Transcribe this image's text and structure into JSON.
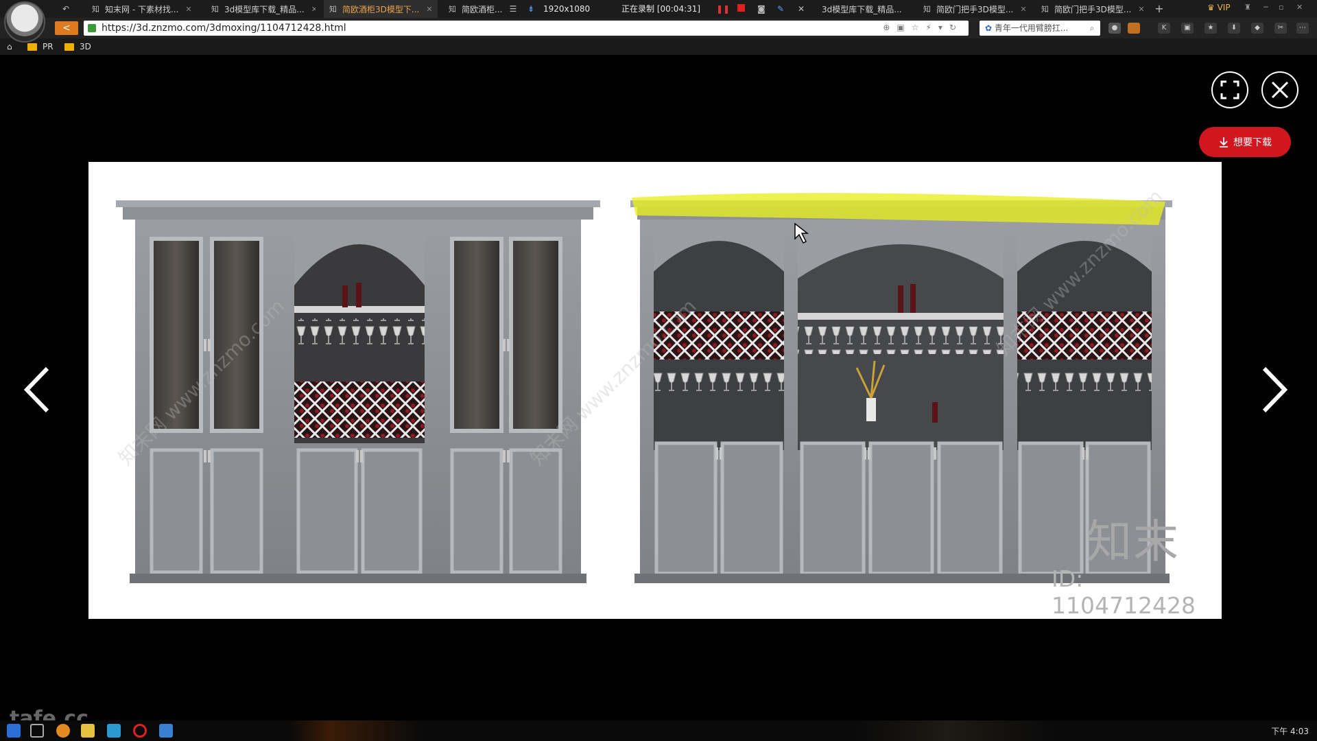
{
  "browser": {
    "tabs": [
      {
        "icon": "知",
        "label": "知末网 - 下素材找..."
      },
      {
        "icon": "知",
        "label": "3d模型库下载_精品..."
      },
      {
        "icon": "知",
        "label": "简欧酒柜3D模型下..."
      },
      {
        "icon": "知",
        "label": "简欧酒柜..."
      },
      {
        "icon": "",
        "label": "3d模型库下载_精品..."
      },
      {
        "icon": "知",
        "label": "简欧门把手3D模型..."
      },
      {
        "icon": "知",
        "label": "简欧门把手3D模型..."
      }
    ],
    "recording": {
      "resolution": "1920x1080",
      "status": "正在录制 [00:04:31]"
    },
    "vip": "VIP",
    "url": "https://3d.znzmo.com/3dmoxing/1104712428.html",
    "search_text": "青年一代用臂膀扛...",
    "bookmarks": [
      "PR",
      "3D"
    ]
  },
  "viewer": {
    "download_label": "想要下载",
    "watermark_logo": "知末",
    "watermark_id": "ID: 1104712428",
    "diag_watermark": "知末网 www.znzmo.com",
    "accent": "#d0161e",
    "highlight": "#e8ee20"
  },
  "taskbar": {
    "clock": "下午 4:03",
    "overlay_brand": "tafe.cc"
  }
}
